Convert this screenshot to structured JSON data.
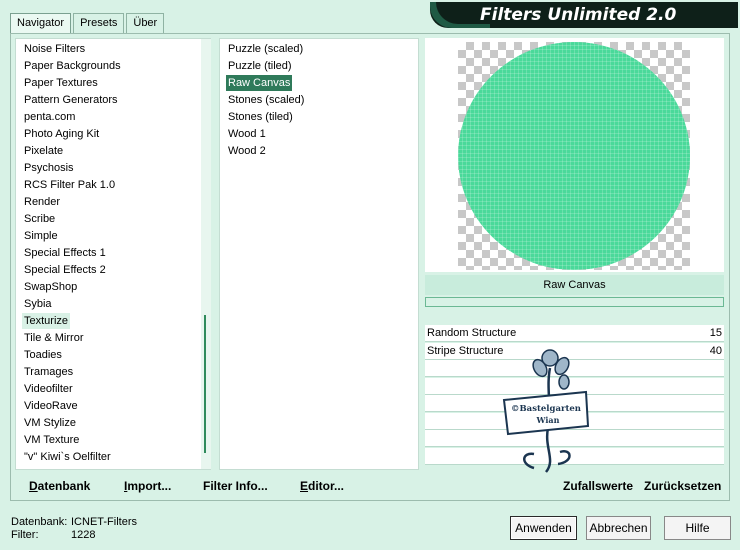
{
  "tabs": [
    "Navigator",
    "Presets",
    "Über"
  ],
  "app_title": "Filters Unlimited 2.0",
  "categories": [
    "Noise Filters",
    "Paper Backgrounds",
    "Paper Textures",
    "Pattern Generators",
    "penta.com",
    "Photo Aging Kit",
    "Pixelate",
    "Psychosis",
    "RCS Filter Pak 1.0",
    "Render",
    "Scribe",
    "Simple",
    "Special Effects 1",
    "Special Effects 2",
    "SwapShop",
    "Sybia",
    "Texturize",
    "Tile & Mirror",
    "Toadies",
    "Tramages",
    "Videofilter",
    "VideoRave",
    "VM Stylize",
    "VM Texture",
    "\"v\" Kiwi`s Oelfilter"
  ],
  "selected_category": "Texturize",
  "filters": [
    "Puzzle (scaled)",
    "Puzzle (tiled)",
    "Raw Canvas",
    "Stones (scaled)",
    "Stones (tiled)",
    "Wood 1",
    "Wood 2"
  ],
  "selected_filter": "Raw Canvas",
  "preview": {
    "filter_name": "Raw Canvas",
    "circle_color": "#4ad99a"
  },
  "params": [
    {
      "label": "Random Structure",
      "value": "15"
    },
    {
      "label": "Stripe Structure",
      "value": "40"
    }
  ],
  "watermark": {
    "line1": "©Bastelgarten",
    "line2": "Wian"
  },
  "buttons": {
    "datenbank": "Datenbank",
    "import": "Import...",
    "filter_info": "Filter Info...",
    "editor": "Editor...",
    "zufallswerte": "Zufallswerte",
    "zuruecksetzen": "Zurücksetzen",
    "anwenden": "Anwenden",
    "abbrechen": "Abbrechen",
    "hilfe": "Hilfe"
  },
  "status": {
    "datenbank_label": "Datenbank:",
    "datenbank_value": "ICNET-Filters",
    "filter_label": "Filter:",
    "filter_value": "1228"
  }
}
